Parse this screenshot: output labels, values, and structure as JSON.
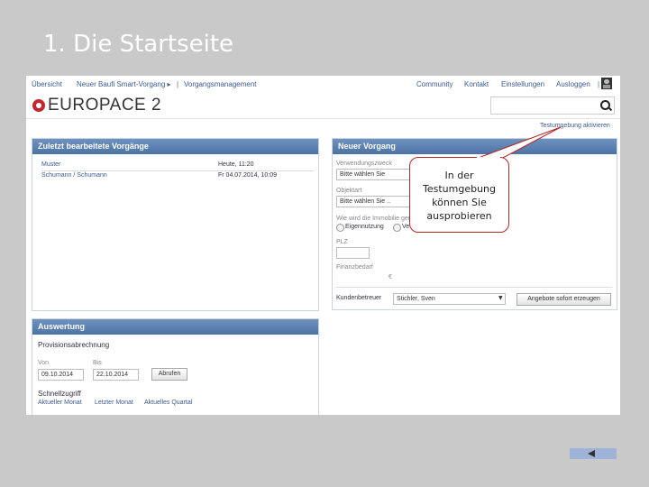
{
  "slide": {
    "title": "1. Die Startseite"
  },
  "topnav": {
    "left_items": [
      "Übersicht",
      "Neuer Baufi Smart-Vorgang ▸",
      "|",
      "Vorgangsmanagement"
    ],
    "right_items": [
      "Community",
      "Kontakt",
      "Einstellungen",
      "Ausloggen",
      "|"
    ]
  },
  "logo": {
    "text": "EUROPACE 2"
  },
  "search": {
    "value": "",
    "placeholder": ""
  },
  "test_link": "Testumgebung aktivieren",
  "recent": {
    "header": "Zuletzt bearbeitete Vorgänge",
    "columns": [
      "Muster",
      "Heute, 11:20"
    ],
    "rows": [
      {
        "name": "Schumann / Schumann",
        "date": "Fr 04.07.2014, 10:09"
      }
    ]
  },
  "new_case": {
    "header": "Neuer Vorgang",
    "purpose_label": "Verwendungszweck",
    "purpose_value": "Bitte wählen Sie",
    "object_label": "Objektart",
    "object_value": "Bitte wählen Sie ..",
    "usage_label": "Wie wird die Immobilie genutzt?",
    "usage_options": [
      "Eigennutzung",
      "Ve"
    ],
    "plz_label": "PLZ",
    "plz_value": "",
    "finance_label": "Finanzbedarf",
    "finance_unit": "€",
    "advisor_label": "Kundenbetreuer",
    "advisor_value": "Stichler, Sven",
    "offer_button": "Angebote sofort erzeugen"
  },
  "evaluation": {
    "header": "Auswertung",
    "section_title": "Provisionsabrechnung",
    "from_label": "Von",
    "from_value": "09.10.2014",
    "to_label": "Bis",
    "to_value": "22.10.2014",
    "fetch_button": "Abrufen",
    "quick_label": "Schnellzugriff",
    "quick_links": [
      "Aktueller Monat",
      "Letzter Monat",
      "Aktuelles Quartal"
    ]
  },
  "callout": {
    "lines": [
      "In der",
      "Testumgebung",
      "können Sie",
      "ausprobieren"
    ]
  },
  "colors": {
    "panel_header": "#4c72a5",
    "callout_border": "#b02a28",
    "brand_red": "#c2272d",
    "slide_bg": "#c9c9c9"
  }
}
